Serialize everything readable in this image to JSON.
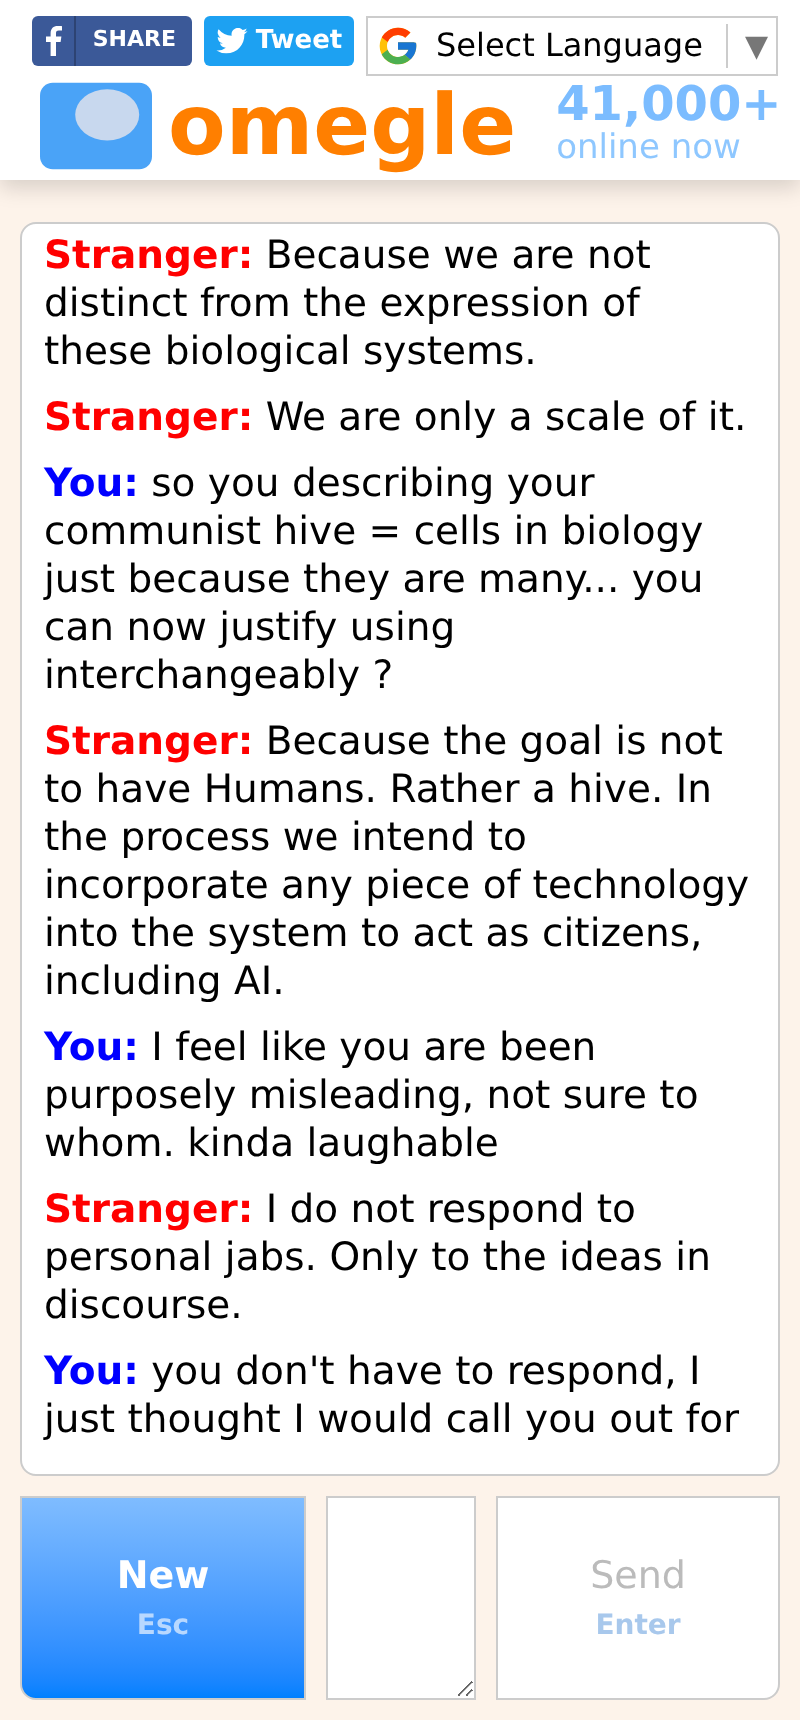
{
  "share_bar": {
    "facebook": "SHARE",
    "twitter": "Tweet",
    "language": "Select Language",
    "language_arrow": "▼"
  },
  "header": {
    "logo": "omegle",
    "online_count": "41,000+",
    "online_label": "online now"
  },
  "messages": [
    {
      "kind": "stranger",
      "sender": "Stranger:",
      "text": "Because we are not distinct from the expression of these biological systems."
    },
    {
      "kind": "stranger",
      "sender": "Stranger:",
      "text": "We are only a scale of it."
    },
    {
      "kind": "you",
      "sender": "You:",
      "text": "so you describing your communist hive = cells in biology just because they are many... you can now justify using interchangeably ?"
    },
    {
      "kind": "stranger",
      "sender": "Stranger:",
      "text": "Because the goal is not to have Humans. Rather a hive. In the process we intend to incorporate any piece of technology into the system to act as citizens, including AI."
    },
    {
      "kind": "you",
      "sender": "You:",
      "text": "I feel like you are been purposely misleading, not sure to whom. kinda laughable"
    },
    {
      "kind": "stranger",
      "sender": "Stranger:",
      "text": "I do not respond to personal jabs. Only to the ideas in discourse."
    },
    {
      "kind": "you",
      "sender": "You:",
      "text": "you don't have to respond, I just thought I would call you out for"
    }
  ],
  "controls": {
    "new_button": {
      "label": "New",
      "hint": "Esc"
    },
    "send_button": {
      "label": "Send",
      "hint": "Enter",
      "disabled": true
    }
  }
}
